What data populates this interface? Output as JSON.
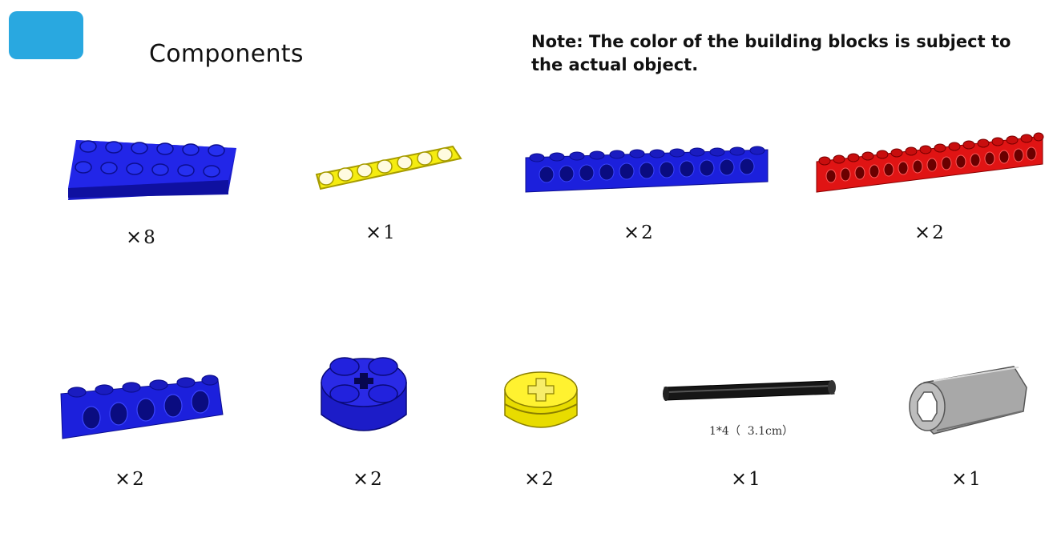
{
  "header": {
    "title": "Components",
    "note": "Note: The color of the building blocks  is subject to the actual object."
  },
  "colors": {
    "badge": "#29a8e0",
    "blue": "#1b1ee0",
    "yellow": "#f5ec10",
    "red": "#e31212",
    "black": "#111111",
    "gray": "#a9a9a9"
  },
  "components": [
    {
      "name": "blue 2x6 plate",
      "icon": "blue-plate-2x6-icon",
      "symbol": "×",
      "count": "8"
    },
    {
      "name": "yellow 7-hole beam",
      "icon": "yellow-beam-7-icon",
      "symbol": "×",
      "count": "1"
    },
    {
      "name": "blue 1x12 technic brick",
      "icon": "blue-brick-1x12-icon",
      "symbol": "×",
      "count": "2"
    },
    {
      "name": "red 1x16 technic brick",
      "icon": "red-brick-1x16-icon",
      "symbol": "×",
      "count": "2"
    },
    {
      "name": "blue 1x6 technic brick",
      "icon": "blue-brick-1x6-icon",
      "symbol": "×",
      "count": "2"
    },
    {
      "name": "blue 2x2 round brick",
      "icon": "blue-round-brick-icon",
      "symbol": "×",
      "count": "2"
    },
    {
      "name": "yellow bush",
      "icon": "yellow-bush-icon",
      "symbol": "×",
      "count": "2"
    },
    {
      "name": "black axle",
      "icon": "black-axle-icon",
      "symbol": "×",
      "count": "1",
      "size": "1*4（  3.1cm）"
    },
    {
      "name": "gray axle connector",
      "icon": "gray-axle-connector-icon",
      "symbol": "×",
      "count": "1"
    }
  ]
}
